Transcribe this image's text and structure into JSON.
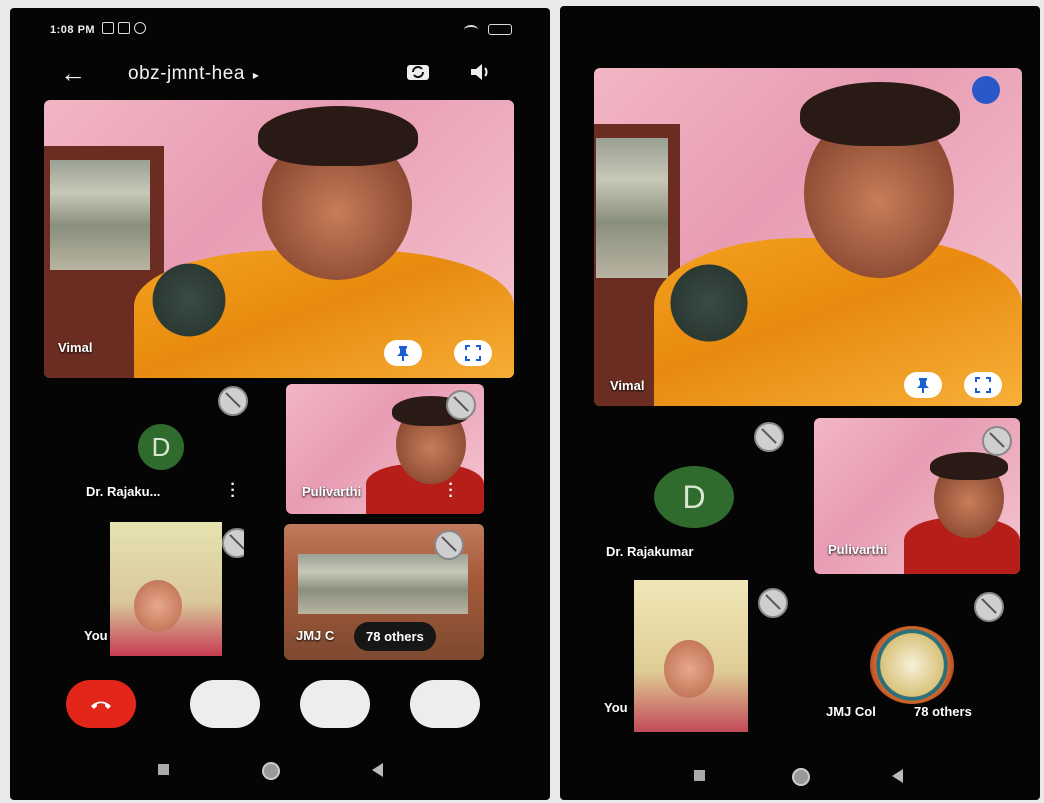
{
  "status_bar": {
    "time": "1:08 PM"
  },
  "app_bar": {
    "meeting_code": "obz-jmnt-hea",
    "caret": "▸"
  },
  "left": {
    "main_speaker": {
      "name": "Vimal"
    },
    "participants": [
      {
        "name": "Dr. Rajaku...",
        "initial": "D"
      },
      {
        "name": "Pulivarthi"
      },
      {
        "name": "You"
      },
      {
        "name": "JMJ C"
      }
    ],
    "others_label": "78 others"
  },
  "right": {
    "main_speaker": {
      "name": "Vimal"
    },
    "participants": [
      {
        "name": "Dr. Rajakumar",
        "initial": "D"
      },
      {
        "name": "Pulivarthi"
      },
      {
        "name": "You"
      },
      {
        "name": "JMJ Col"
      }
    ],
    "others_label": "78 others"
  },
  "colors": {
    "end_call": "#e3261a",
    "avatar_bg": "#2e6b2c",
    "background": "#050505"
  },
  "icons": [
    "back-arrow-icon",
    "switch-camera-icon",
    "speaker-icon",
    "pin-icon",
    "fullscreen-icon",
    "mic-off-icon",
    "more-vert-icon",
    "end-call-icon",
    "nav-recents-icon",
    "nav-home-icon",
    "nav-back-icon"
  ]
}
